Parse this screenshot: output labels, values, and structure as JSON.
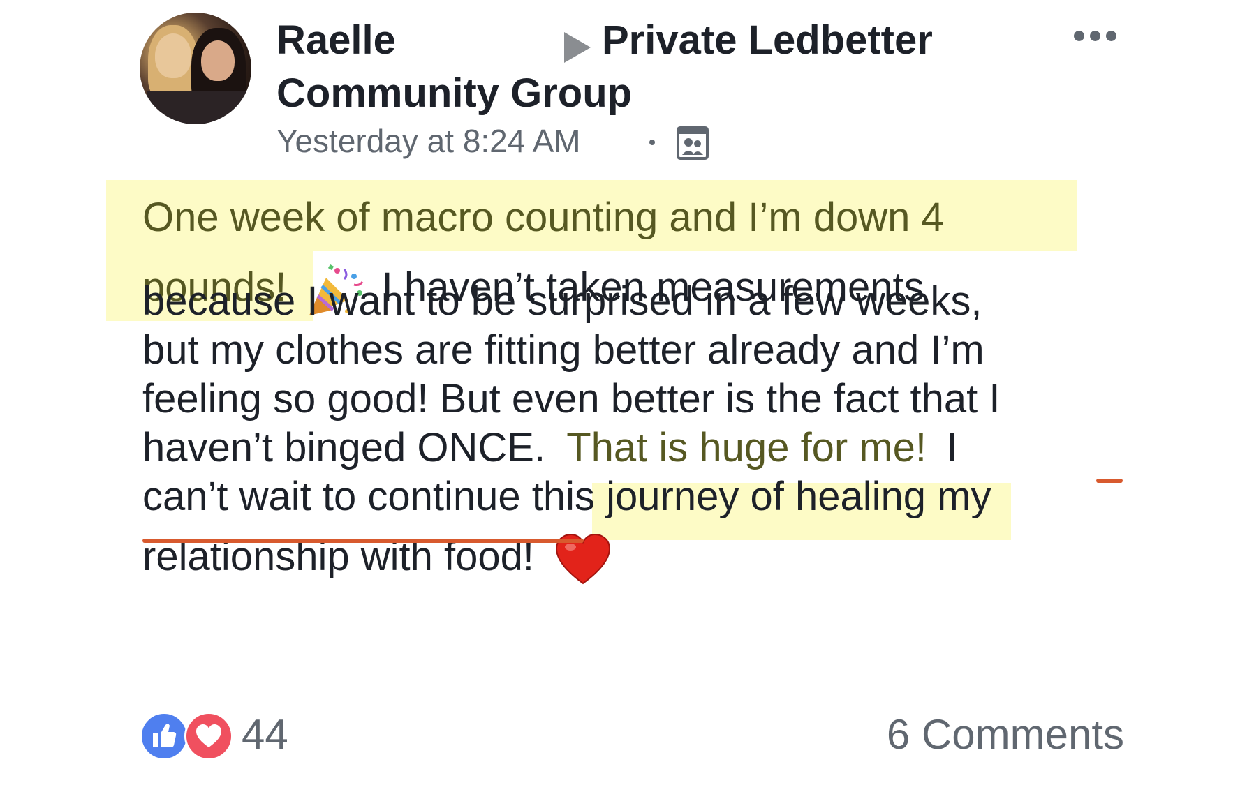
{
  "post": {
    "author": "Raelle",
    "group_name_line1": "Private Ledbetter",
    "group_name_line2": "Community Group",
    "timestamp": "Yesterday at 8:24 AM",
    "privacy_icon": "group-members-icon",
    "body_lines": [
      "One week of macro counting and I’m down 4",
      "pounds!",
      "I haven’t taken measurements",
      "because I want to be surprised in a few weeks,",
      "but my clothes are fitting better already and I’m",
      "feeling so good! But even better is the fact that I",
      "haven’t binged ONCE.",
      "That is huge for me!",
      "I",
      "can’t wait to continue this journey of healing my",
      "relationship with food!"
    ],
    "emoji": [
      "party-popper-emoji",
      "red-heart-emoji"
    ],
    "highlight_color": "#fdfbc6",
    "underline_color": "#d85a2e"
  },
  "footer": {
    "reaction_count": "44",
    "comments_label": "6 Comments",
    "like_color": "#4f7fef",
    "love_color": "#f0505f"
  }
}
